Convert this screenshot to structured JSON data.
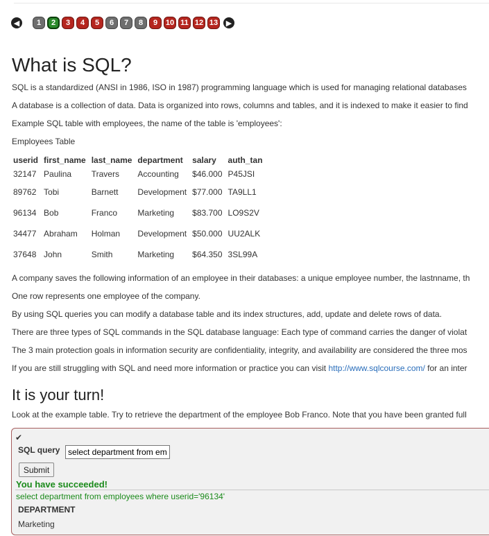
{
  "nav": {
    "prev_glyph": "◀",
    "next_glyph": "▶",
    "pages": [
      {
        "label": "1",
        "state": "gray"
      },
      {
        "label": "2",
        "state": "green"
      },
      {
        "label": "3",
        "state": "red"
      },
      {
        "label": "4",
        "state": "red"
      },
      {
        "label": "5",
        "state": "red"
      },
      {
        "label": "6",
        "state": "gray"
      },
      {
        "label": "7",
        "state": "gray"
      },
      {
        "label": "8",
        "state": "gray"
      },
      {
        "label": "9",
        "state": "red"
      },
      {
        "label": "10",
        "state": "red"
      },
      {
        "label": "11",
        "state": "red"
      },
      {
        "label": "12",
        "state": "red"
      },
      {
        "label": "13",
        "state": "red"
      }
    ]
  },
  "lesson": {
    "title": "What is SQL?",
    "intro1": "SQL is a standardized (ANSI in 1986, ISO in 1987) programming language which is used for managing relational databases",
    "intro2": "A database is a collection of data. Data is organized into rows, columns and tables, and it is indexed to make it easier to find",
    "intro3": "Example SQL table with employees, the name of the table is 'employees':",
    "table_caption": "Employees Table",
    "table": {
      "headers": [
        "userid",
        "first_name",
        "last_name",
        "department",
        "salary",
        "auth_tan"
      ],
      "rows": [
        [
          "32147",
          "Paulina",
          "Travers",
          "Accounting",
          "$46.000",
          "P45JSI"
        ],
        [
          "89762",
          "Tobi",
          "Barnett",
          "Development",
          "$77.000",
          "TA9LL1"
        ],
        [
          "96134",
          "Bob",
          "Franco",
          "Marketing",
          "$83.700",
          "LO9S2V"
        ],
        [
          "34477",
          "Abraham",
          "Holman",
          "Development",
          "$50.000",
          "UU2ALK"
        ],
        [
          "37648",
          "John",
          "Smith",
          "Marketing",
          "$64.350",
          "3SL99A"
        ]
      ]
    },
    "after1": "A company saves the following information of an employee in their databases: a unique employee number, the lastnname, th",
    "after2": "One row represents one employee of the company.",
    "after3": "By using SQL queries you can modify a database table and its index structures, add, update and delete rows of data.",
    "after4": "There are three types of SQL commands in the SQL database language: Each type of command carries the danger of violat",
    "after5": "The 3 main protection goals in information security are confidentiality, integrity, and availability are considered the three mos",
    "after6_pre": "If you are still struggling with SQL and need more information or practice you can visit ",
    "after6_link": "http://www.sqlcourse.com/",
    "after6_post": " for an inter"
  },
  "task": {
    "title": "It is your turn!",
    "instructions": "Look at the example table. Try to retrieve the department of the employee Bob Franco. Note that you have been granted full",
    "check_glyph": "✔",
    "query_label": "SQL query",
    "query_value": "select department from employees where userid='96134'",
    "submit_label": "Submit",
    "success_text": "You have succeeded!",
    "executed_query": "select department from employees where userid='96134'",
    "result_header": "DEPARTMENT",
    "result_value": "Marketing"
  }
}
